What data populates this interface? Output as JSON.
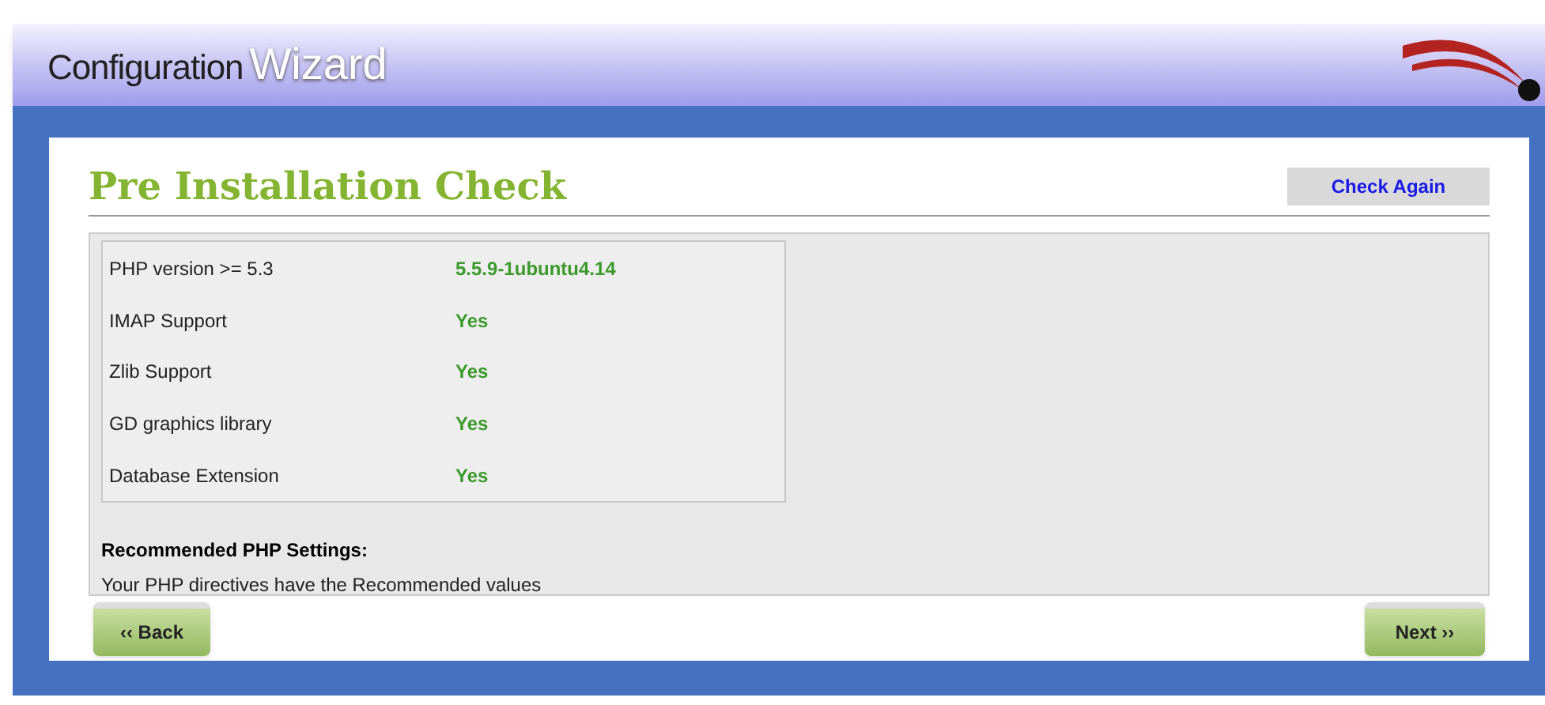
{
  "header": {
    "title_part1": "Configuration",
    "title_part2": "Wizard"
  },
  "page_title": "Pre Installation Check",
  "check_again_button": "Check Again",
  "checks": [
    {
      "label": "PHP version >= 5.3",
      "value": "5.5.9-1ubuntu4.14"
    },
    {
      "label": "IMAP Support",
      "value": "Yes"
    },
    {
      "label": "Zlib Support",
      "value": "Yes"
    },
    {
      "label": "GD graphics library",
      "value": "Yes"
    },
    {
      "label": "Database Extension",
      "value": "Yes"
    }
  ],
  "recommended": {
    "heading": "Recommended PHP Settings:",
    "message": "Your PHP directives have the Recommended values"
  },
  "buttons": {
    "back": "‹‹ Back",
    "next": "Next ››"
  }
}
